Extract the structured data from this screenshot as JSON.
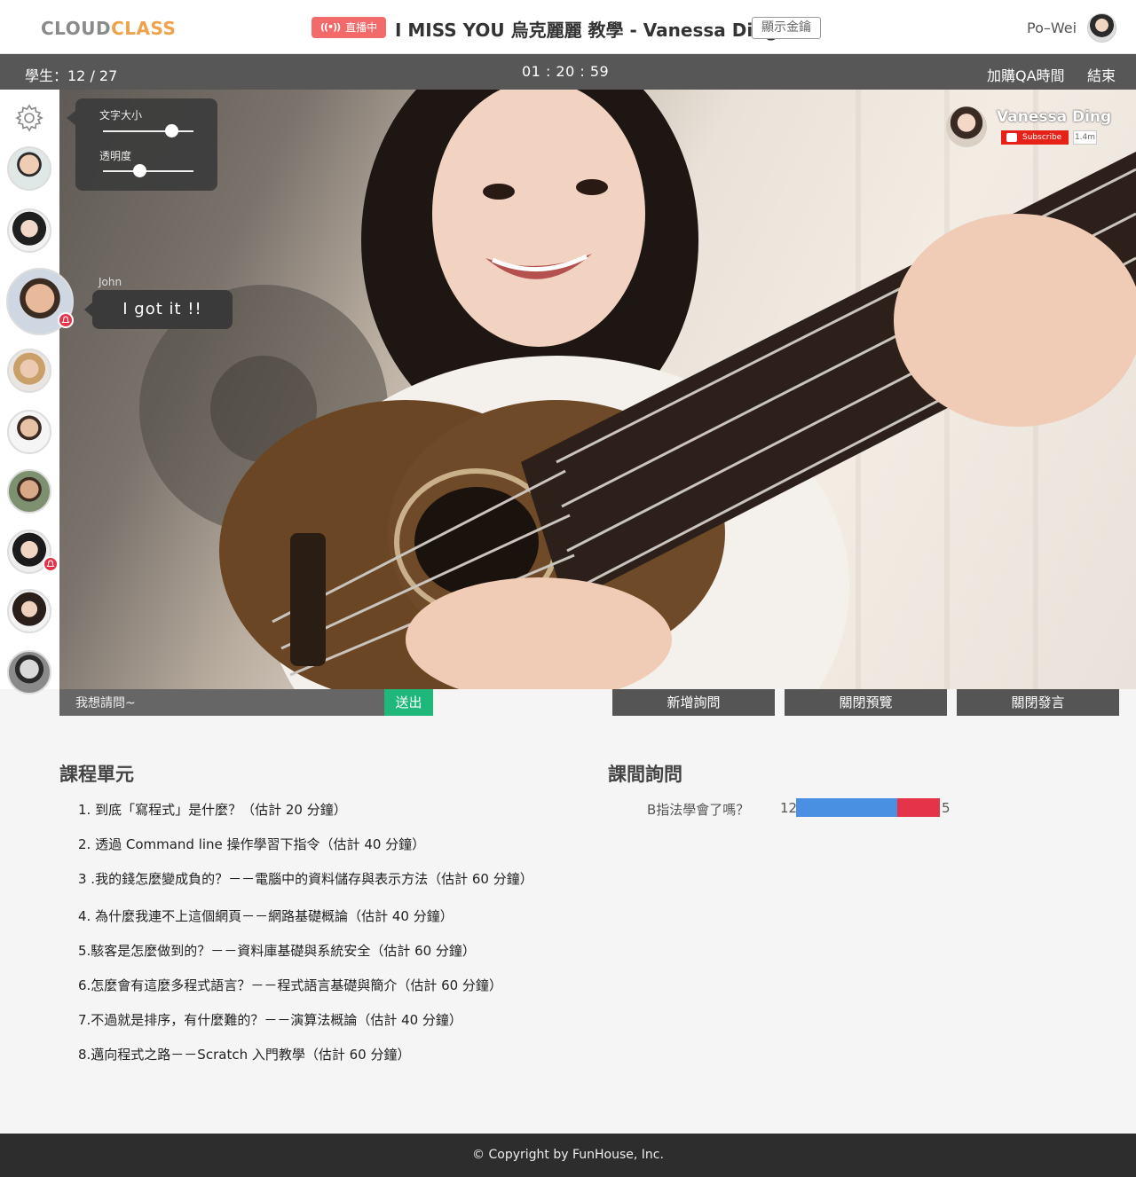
{
  "header": {
    "logo_part1": "CLOUD",
    "logo_part2": "CLASS",
    "live_label": "直播中",
    "course_title": "I MISS YOU 烏克麗麗 教學 - Vanessa Ding",
    "show_price_label": "顯示金鑰",
    "user_name": "Po–Wei"
  },
  "status": {
    "students": "學生：12 / 27",
    "timer": "01 : 20 : 59",
    "buy_qa_label": "加購QA時間",
    "end_label": "結束"
  },
  "settings": {
    "font_size_label": "文字大小",
    "font_size_value": 0.75,
    "opacity_label": "透明度",
    "opacity_value": 0.4
  },
  "chat": {
    "sender": "John",
    "message": "I got it !!"
  },
  "youtube": {
    "channel": "Vanessa Ding",
    "subscribe_label": "Subscribe",
    "subscriber_count": "1.4m"
  },
  "question_input": {
    "value": "我想請問~",
    "send_label": "送出"
  },
  "actions": {
    "add_question": "新增詢問",
    "close_preview": "關閉預覽",
    "close_speech": "關閉發言"
  },
  "units": {
    "title": "課程單元",
    "items": [
      "1. 到底「寫程式」是什麼？（估計 20 分鐘）",
      "2. 透過 Command line 操作學習下指令（估計 40 分鐘）",
      "3 .我的錢怎麼變成負的？－－電腦中的資料儲存與表示方法（估計 60 分鐘）",
      "4. 為什麼我連不上這個網頁－－網路基礎概論（估計 40 分鐘）",
      "5.駭客是怎麼做到的？－－資料庫基礎與系統安全（估計 60 分鐘）",
      "6.怎麼會有這麼多程式語言？－－程式語言基礎與簡介（估計 60 分鐘）",
      "7.不過就是排序，有什麼難的？－－演算法概論（估計 40 分鐘）",
      "8.邁向程式之路－－Scratch 入門教學（估計 60 分鐘）"
    ]
  },
  "qa": {
    "title": "課間詢問",
    "question": "B指法學會了嗎？",
    "yes_count": "12",
    "no_count": "5"
  },
  "footer": {
    "copyright": "© Copyright by FunHouse, Inc."
  },
  "colors": {
    "accent_green": "#1fb87a",
    "live_red": "#f26a6a",
    "bar_blue": "#4a90e2",
    "bar_red": "#e5344a",
    "logo_orange": "#f0a24a"
  }
}
